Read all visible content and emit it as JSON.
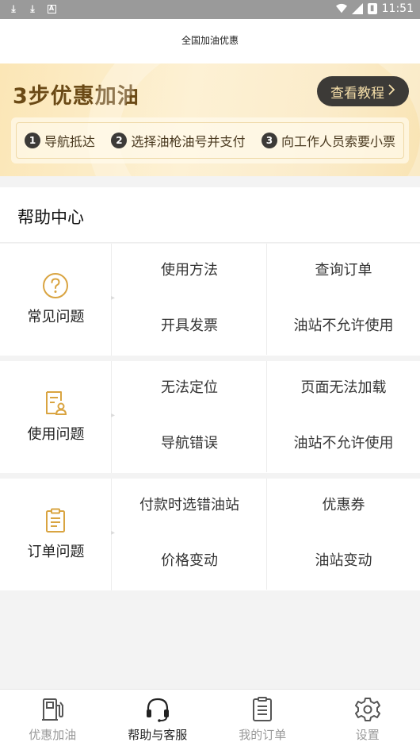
{
  "status_bar": {
    "time": "11:51",
    "left_icons": [
      "download-icon",
      "download-icon",
      "app-a-icon"
    ],
    "right_icons": [
      "wifi-icon",
      "signal-icon",
      "battery-icon"
    ]
  },
  "header": {
    "title": "全国加油优惠"
  },
  "banner": {
    "headline": "3步优惠加油",
    "tutorial_button": "查看教程",
    "steps": [
      {
        "num": "1",
        "label": "导航抵达"
      },
      {
        "num": "2",
        "label": "选择油枪油号并支付"
      },
      {
        "num": "3",
        "label": "向工作人员索要小票"
      }
    ]
  },
  "help_center": {
    "title": "帮助中心",
    "sections": [
      {
        "category": "常见问题",
        "icon": "question-circle-icon",
        "links": [
          "使用方法",
          "查询订单",
          "开具发票",
          "油站不允许使用"
        ]
      },
      {
        "category": "使用问题",
        "icon": "document-user-icon",
        "links": [
          "无法定位",
          "页面无法加载",
          "导航错误",
          "油站不允许使用"
        ]
      },
      {
        "category": "订单问题",
        "icon": "clipboard-icon",
        "links": [
          "付款时选错油站",
          "优惠券",
          "价格变动",
          "油站变动"
        ]
      }
    ]
  },
  "bottom_nav": [
    {
      "label": "优惠加油",
      "icon": "fuel-pump-icon",
      "active": false
    },
    {
      "label": "帮助与客服",
      "icon": "headset-icon",
      "active": true
    },
    {
      "label": "我的订单",
      "icon": "order-list-icon",
      "active": false
    },
    {
      "label": "设置",
      "icon": "settings-gear-icon",
      "active": false
    }
  ],
  "colors": {
    "accent_gold": "#d9a441",
    "dark_button": "#3c3a37",
    "banner_text": "#6b4a16"
  }
}
